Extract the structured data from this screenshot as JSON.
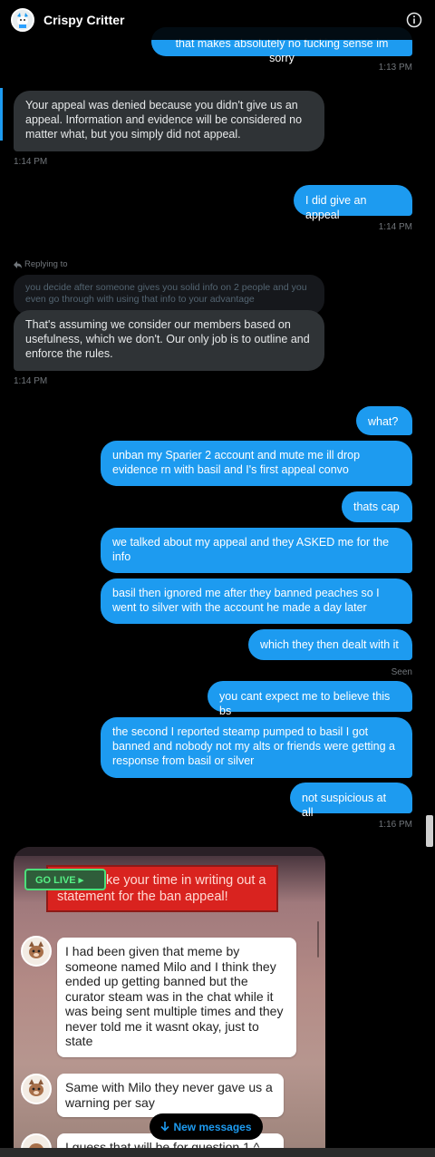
{
  "header": {
    "title": "Crispy Critter"
  },
  "messages": {
    "m0": {
      "text": "that makes absolutely no fucking sense im sorry",
      "time": "1:13 PM"
    },
    "m1": {
      "text": "Your appeal was denied because you didn't give us an appeal. Information and evidence will be considered no matter what, but you simply did not appeal.",
      "time": "1:14 PM"
    },
    "m2": {
      "text": "I did give an appeal",
      "time": "1:14 PM"
    },
    "m3": {
      "replying_label": "Replying to",
      "quoted": "you decide after someone gives you solid info on 2 people and you even go through with using that info to your advantage",
      "text": "That's assuming we consider our members based on usefulness, which we don't. Our only job is to outline and enforce the rules.",
      "time": "1:14 PM"
    },
    "m4": {
      "text": "what?"
    },
    "m5": {
      "text": "unban my Sparier 2 account and mute me ill drop evidence rn with basil and I's first appeal convo"
    },
    "m6": {
      "text": "thats cap"
    },
    "m7": {
      "text": "we talked about my appeal and they ASKED me for the info"
    },
    "m8": {
      "text": "basil then ignored me after they banned peaches so I went to silver with the account he made a day later"
    },
    "m9": {
      "text": "which they then dealt with it",
      "status": "Seen"
    },
    "m10": {
      "text": "you cant expect me to believe this bs"
    },
    "m11": {
      "text": "the second I reported steamp pumped to basil I got banned and nobody not my alts or friends were getting a response from basil or silver"
    },
    "m12": {
      "text": "not suspicious at all",
      "time": "1:16 PM"
    }
  },
  "image": {
    "golive": "GO LIVE ▸",
    "banner_line1": "ke your time in writing out a",
    "banner_line2": "statement for the ban appeal!",
    "msg1": "I had been given that meme by someone named Milo and I think they ended up getting banned but the curator steam was in the chat while it was being sent multiple times and they never told me it wasnt okay, just to state",
    "msg2": "Same with Milo they never gave us a warning per say",
    "msg3": "I guess that will be for question 1 ^"
  },
  "new_messages": {
    "label": "New messages"
  },
  "colors": {
    "sent": "#1d9bf0",
    "received": "#2f3336",
    "background": "#000000",
    "golive": "#4be07a",
    "banner": "#d9231f"
  },
  "icons": [
    "info-icon",
    "reply-arrow-icon",
    "down-arrow-icon",
    "avatar"
  ]
}
